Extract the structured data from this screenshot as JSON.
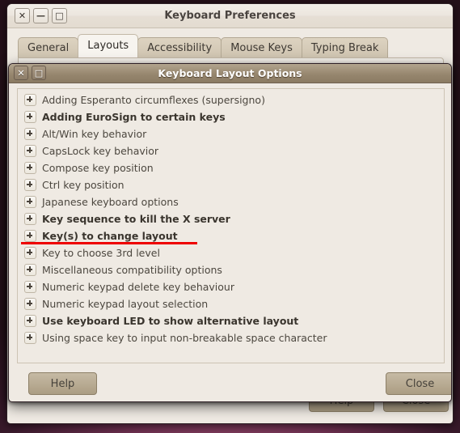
{
  "parent_window": {
    "title": "Keyboard Preferences",
    "titlebar_buttons": [
      {
        "name": "close",
        "glyph": "✕"
      },
      {
        "name": "minimize",
        "glyph": "—"
      },
      {
        "name": "maximize",
        "glyph": "□"
      }
    ],
    "tabs": [
      {
        "label": "General",
        "active": false
      },
      {
        "label": "Layouts",
        "active": true
      },
      {
        "label": "Accessibility",
        "active": false
      },
      {
        "label": "Mouse Keys",
        "active": false
      },
      {
        "label": "Typing Break",
        "active": false
      }
    ],
    "help_label": "Help",
    "close_label": "Close"
  },
  "dialog": {
    "title": "Keyboard Layout Options",
    "titlebar_buttons": [
      {
        "name": "close",
        "glyph": "✕"
      },
      {
        "name": "maximize",
        "glyph": "□"
      }
    ],
    "options": [
      {
        "label": "Adding Esperanto circumflexes (supersigno)",
        "bold": false,
        "expanded": false
      },
      {
        "label": "Adding EuroSign to certain keys",
        "bold": true,
        "expanded": false
      },
      {
        "label": "Alt/Win key behavior",
        "bold": false,
        "expanded": false
      },
      {
        "label": "CapsLock key behavior",
        "bold": false,
        "expanded": false
      },
      {
        "label": "Compose key position",
        "bold": false,
        "expanded": false
      },
      {
        "label": "Ctrl key position",
        "bold": false,
        "expanded": false
      },
      {
        "label": "Japanese keyboard options",
        "bold": false,
        "expanded": false
      },
      {
        "label": "Key sequence to kill the X server",
        "bold": true,
        "expanded": false
      },
      {
        "label": "Key(s) to change layout",
        "bold": true,
        "expanded": false,
        "annotated": true
      },
      {
        "label": "Key to choose 3rd level",
        "bold": false,
        "expanded": false
      },
      {
        "label": "Miscellaneous compatibility options",
        "bold": false,
        "expanded": false
      },
      {
        "label": "Numeric keypad delete key behaviour",
        "bold": false,
        "expanded": false
      },
      {
        "label": "Numeric keypad layout selection",
        "bold": false,
        "expanded": false
      },
      {
        "label": "Use keyboard LED to show alternative layout",
        "bold": true,
        "expanded": false
      },
      {
        "label": "Using space key to input non-breakable space character",
        "bold": false,
        "expanded": false
      }
    ],
    "help_label": "Help",
    "close_label": "Close"
  },
  "annotation": {
    "target_label": "Key(s) to change layout",
    "color": "#ee0000",
    "style": "underline"
  },
  "colors": {
    "desktop": "#6e3050",
    "window_bg": "#efeae3",
    "tab_active_bg": "#f7f4ef",
    "tab_inactive_bg": "#cfc4b0",
    "dialog_titlebar": "#97876f",
    "button_bg": "#ab9d83",
    "annotation_red": "#ee0000",
    "text": "#4c473f"
  }
}
